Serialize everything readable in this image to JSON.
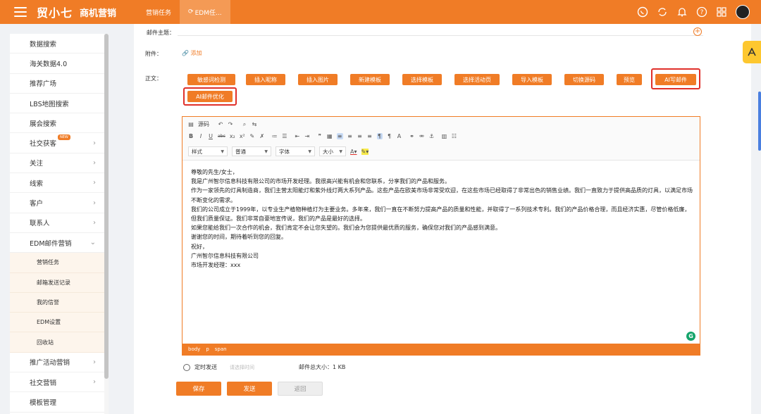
{
  "topbar": {
    "logo": "贸小七",
    "brand": "商机营销",
    "tabs": [
      "营销任务",
      "EDM任..."
    ]
  },
  "sidebar": {
    "items": [
      {
        "label": "数据搜索"
      },
      {
        "label": "海关数据4.0"
      },
      {
        "label": "推荐广场"
      },
      {
        "label": "LBS地图搜索"
      },
      {
        "label": "展会搜索"
      },
      {
        "label": "社交获客",
        "badge": "NEW",
        "chev": "›"
      },
      {
        "label": "关注",
        "chev": "›"
      },
      {
        "label": "线索",
        "chev": "›"
      },
      {
        "label": "客户",
        "chev": "›"
      },
      {
        "label": "联系人",
        "chev": "›"
      },
      {
        "label": "EDM邮件营销",
        "chev": "⌄"
      }
    ],
    "subitems": [
      "营销任务",
      "邮箱发送记录",
      "我的信誉",
      "EDM设置",
      "回收站"
    ],
    "items_after": [
      {
        "label": "推广活动营销",
        "chev": "›"
      },
      {
        "label": "社交营销",
        "chev": "›"
      },
      {
        "label": "模板管理"
      }
    ]
  },
  "form": {
    "subject_label": "邮件主题：",
    "attachment_label": "附件：",
    "attach_link": "添加",
    "body_label": "正文："
  },
  "buttons": [
    "敏感词检测",
    "插入昵称",
    "插入图片",
    "新建模板",
    "选择模板",
    "选择活动页",
    "导入模板",
    "切换源码",
    "预览",
    "AI写邮件",
    "AI邮件优化"
  ],
  "editor": {
    "source_label": "源码",
    "selects": [
      "样式",
      "普通",
      "字体",
      "大小"
    ],
    "content": [
      "尊敬的先生/女士，",
      "我是广州智尔信息科技有限公司的市场开发经理。我很高兴能有机会和您联系，分享我们的产品和服务。",
      "作为一家领先的灯具制造商，我们主营太阳能灯和紫外线灯两大系列产品。这些产品在欧美市场非常受欢迎，在这些市场已经取得了非常出色的销售业绩。我们一直致力于提供高品质的灯具，以满足市场不断变化的需求。",
      "我们的公司成立于1999年，以专业生产植物种植灯为主要业务。多年来，我们一直在不断努力提高产品的质量和性能，并取得了一系列技术专利。我们的产品价格合理，而且经济实惠，尽管价格低廉，但我们质量保证。我们非常自豪地宣传说，我们的产品是最好的选择。",
      "如果您能给我们一次合作的机会，我们肯定不会让您失望的。我们会为您提供最优质的服务，确保您对我们的产品感到满意。",
      "谢谢您的时间，期待着听到您的回复。",
      "祝好，",
      "广州智尔信息科技有限公司",
      "市场开发经理：xxx"
    ],
    "status_path": [
      "body",
      "p",
      "span"
    ]
  },
  "schedule": {
    "label": "定时发送",
    "placeholder": "请选择时间"
  },
  "size_text": "邮件总大小：1 KB",
  "actions": {
    "save": "保存",
    "send": "发送",
    "back": "返回"
  },
  "colors": {
    "accent": "#f07c26",
    "highlight": "#e0302a"
  }
}
